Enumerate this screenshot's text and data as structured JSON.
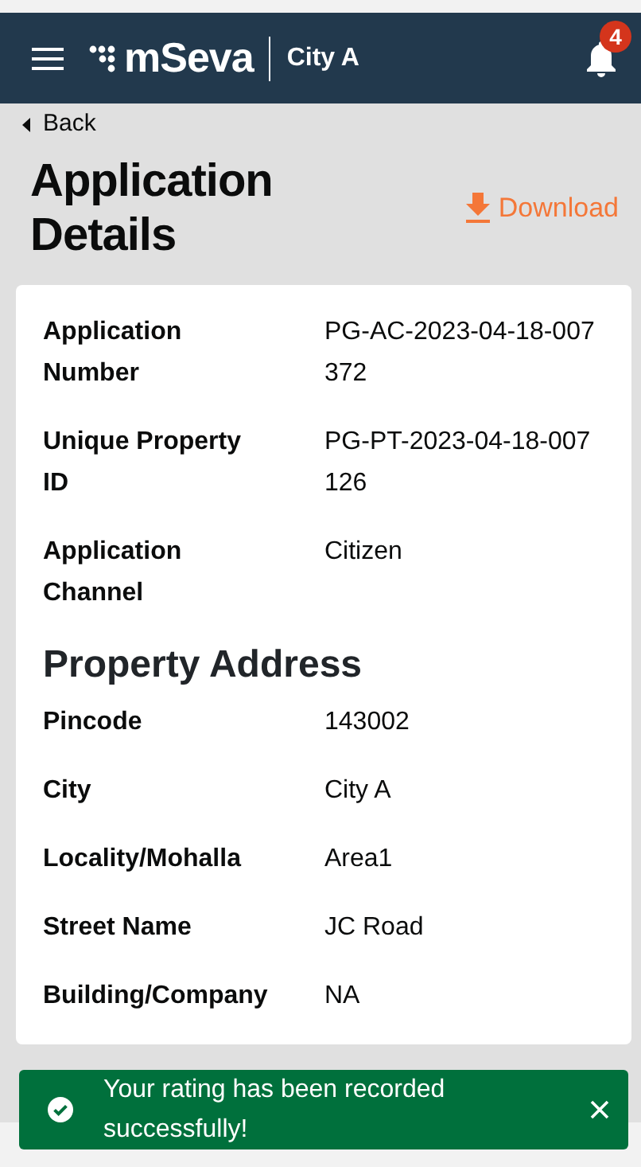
{
  "header": {
    "brand": "mSeva",
    "city": "City A",
    "notification_count": "4"
  },
  "back": "Back",
  "title": "Application Details",
  "download": "Download",
  "details": [
    {
      "label": "Application Number",
      "value": "PG-AC-2023-04-18-007372"
    },
    {
      "label": "Unique Property ID",
      "value": "PG-PT-2023-04-18-007126"
    },
    {
      "label": "Application Channel",
      "value": "Citizen"
    }
  ],
  "address": {
    "heading": "Property Address",
    "rows": [
      {
        "label": "Pincode",
        "value": "143002"
      },
      {
        "label": "City",
        "value": "City A"
      },
      {
        "label": "Locality/Mohalla",
        "value": "Area1"
      },
      {
        "label": "Street Name",
        "value": "JC Road"
      },
      {
        "label": "Building/Company",
        "value": "NA"
      }
    ]
  },
  "toast": {
    "message": "Your rating has been recorded successfully!"
  }
}
